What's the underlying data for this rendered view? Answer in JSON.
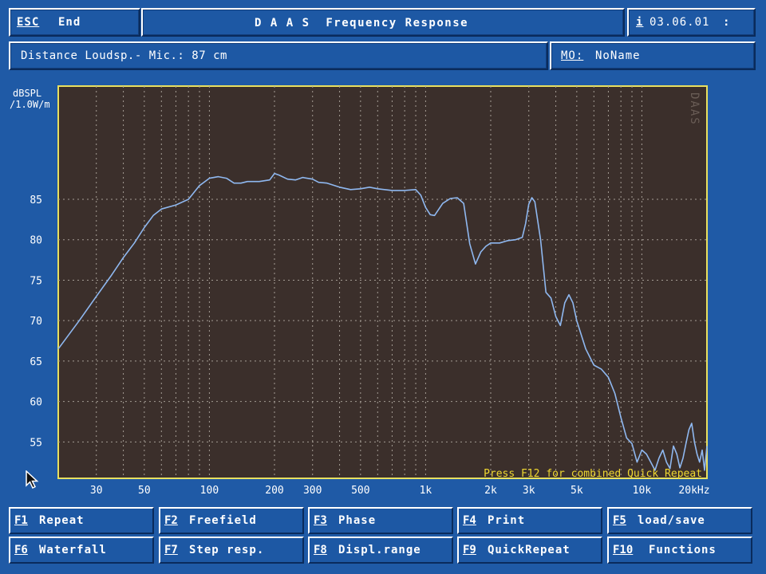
{
  "header": {
    "esc_key": "ESC",
    "esc_label": "End",
    "title": "D A A S  Frequency Response",
    "info_key": "i",
    "date": "03.06.01",
    "date_suffix": ":"
  },
  "subheader": {
    "distance": "Distance Loudsp.- Mic.: 87 cm",
    "mic_key": "MO:",
    "mic_name": "NoName"
  },
  "chart_data": {
    "type": "line",
    "ylabel_line1": "dBSPL",
    "ylabel_line2": "/1.0W/m",
    "xunit": "kHz",
    "xscale": "log",
    "xlim": [
      20,
      20000
    ],
    "ylim": [
      50.5,
      99
    ],
    "yticks": [
      55,
      60,
      65,
      70,
      75,
      80,
      85
    ],
    "xticks": [
      {
        "v": 30,
        "label": "30"
      },
      {
        "v": 50,
        "label": "50"
      },
      {
        "v": 100,
        "label": "100"
      },
      {
        "v": 200,
        "label": "200"
      },
      {
        "v": 300,
        "label": "300"
      },
      {
        "v": 500,
        "label": "500"
      },
      {
        "v": 1000,
        "label": "1k"
      },
      {
        "v": 2000,
        "label": "2k"
      },
      {
        "v": 3000,
        "label": "3k"
      },
      {
        "v": 5000,
        "label": "5k"
      },
      {
        "v": 10000,
        "label": "10k"
      },
      {
        "v": 20000,
        "label": "20kHz"
      }
    ],
    "grid": true,
    "watermark": "DAAS",
    "note": "Press F12 for combined Quick Repeat",
    "colors": {
      "plot_bg": "#3b2f2b",
      "line": "#8fb8f0",
      "grid": "#a49c94",
      "frame": "#e8e060",
      "note": "#f0d830"
    },
    "series": [
      {
        "x": [
          20,
          25,
          30,
          35,
          40,
          45,
          50,
          55,
          60,
          70,
          80,
          90,
          100,
          110,
          120,
          130,
          140,
          150,
          170,
          190,
          200,
          210,
          230,
          250,
          270,
          300,
          320,
          350,
          400,
          450,
          500,
          550,
          600,
          700,
          800,
          900,
          950,
          1000,
          1050,
          1100,
          1200,
          1300,
          1400,
          1500,
          1600,
          1700,
          1800,
          1900,
          2000,
          2200,
          2400,
          2600,
          2800,
          2900,
          3000,
          3100,
          3200,
          3400,
          3600,
          3800,
          4000,
          4200,
          4400,
          4600,
          4800,
          5000,
          5500,
          6000,
          6500,
          7000,
          7500,
          8000,
          8500,
          9000,
          9500,
          10000,
          10500,
          11000,
          11500,
          12000,
          12500,
          13000,
          13500,
          14000,
          14500,
          15000,
          15500,
          16000,
          16500,
          17000,
          17500,
          18000,
          18500,
          19000,
          19500,
          20000
        ],
        "y": [
          66.5,
          70,
          73,
          75.5,
          77.8,
          79.6,
          81.5,
          83,
          83.8,
          84.3,
          85,
          86.7,
          87.6,
          87.8,
          87.6,
          87,
          87,
          87.2,
          87.2,
          87.4,
          88.2,
          88,
          87.5,
          87.4,
          87.7,
          87.5,
          87.1,
          87,
          86.5,
          86.2,
          86.3,
          86.5,
          86.3,
          86.1,
          86.1,
          86.2,
          85.5,
          84,
          83.1,
          83,
          84.5,
          85.1,
          85.2,
          84.5,
          79.5,
          77,
          78.5,
          79.2,
          79.6,
          79.6,
          79.9,
          80,
          80.3,
          82,
          84.4,
          85.2,
          84.7,
          80,
          73.5,
          72.8,
          70.5,
          69.4,
          72.2,
          73.2,
          72.2,
          70,
          66.5,
          64.5,
          64,
          63,
          61,
          58,
          55.5,
          54.8,
          52.5,
          54,
          53.5,
          52.5,
          51.5,
          53,
          54,
          52.5,
          51.7,
          54.5,
          53.5,
          51.8,
          53,
          54.8,
          56.5,
          57.3,
          55,
          53.5,
          52.5,
          54,
          51.5,
          54.5
        ]
      }
    ]
  },
  "fkeys": [
    {
      "key": "F1",
      "label": "Repeat"
    },
    {
      "key": "F2",
      "label": "Freefield"
    },
    {
      "key": "F3",
      "label": "Phase"
    },
    {
      "key": "F4",
      "label": "Print"
    },
    {
      "key": "F5",
      "label": "load/save"
    },
    {
      "key": "F6",
      "label": "Waterfall"
    },
    {
      "key": "F7",
      "label": "Step resp."
    },
    {
      "key": "F8",
      "label": "Displ.range"
    },
    {
      "key": "F9",
      "label": "QuickRepeat"
    },
    {
      "key": "F10",
      "label": "Functions"
    }
  ]
}
